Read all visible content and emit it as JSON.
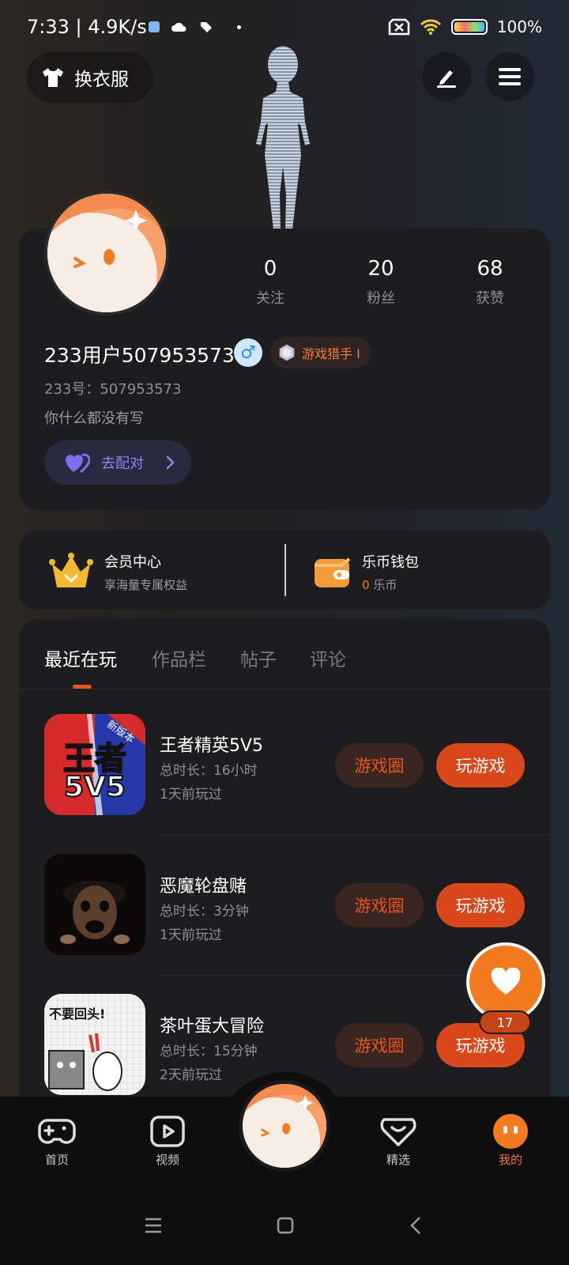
{
  "status_bar": {
    "time": "7:33 | 4.9K/s",
    "battery": "100%"
  },
  "header": {
    "outfit_label": "换衣服"
  },
  "profile": {
    "stats": [
      {
        "value": "0",
        "label": "关注"
      },
      {
        "value": "20",
        "label": "粉丝"
      },
      {
        "value": "68",
        "label": "获赞"
      }
    ],
    "username": "233用户507953573",
    "gender_symbol": "♂",
    "badge": "游戏猎手 Ⅰ",
    "id_text": "233号：507953573",
    "bio": "你什么都没有写",
    "match_label": "去配对"
  },
  "vip": {
    "member_title": "会员中心",
    "member_sub": "享海量专属权益",
    "wallet_title": "乐币钱包",
    "wallet_amount": "0",
    "wallet_unit": "乐币"
  },
  "tabs": [
    "最近在玩",
    "作品栏",
    "帖子",
    "评论"
  ],
  "games": [
    {
      "name": "王者精英5V5",
      "duration": "总时长：16小时",
      "last_played": "1天前玩过",
      "icon_text": "王者",
      "icon_sub": "5V5",
      "icon_corner": "新版本"
    },
    {
      "name": "恶魔轮盘赌",
      "duration": "总时长：3分钟",
      "last_played": "1天前玩过"
    },
    {
      "name": "茶叶蛋大冒险",
      "duration": "总时长：15分钟",
      "last_played": "2天前玩过",
      "icon_text": "不要回头!"
    }
  ],
  "game_buttons": {
    "circle": "游戏圈",
    "play": "玩游戏"
  },
  "like_count": "17",
  "nav": [
    "首页",
    "视频",
    "精选",
    "我的"
  ],
  "colors": {
    "accent": "#e4571c",
    "orange": "#f47a1f",
    "card": "#1d1d1f"
  }
}
